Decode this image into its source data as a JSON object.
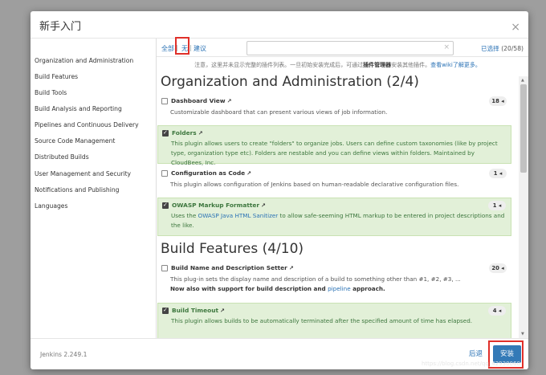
{
  "modal": {
    "title": "新手入门",
    "close": "×"
  },
  "sidebar": {
    "items": [
      "Organization and Administration",
      "Build Features",
      "Build Tools",
      "Build Analysis and Reporting",
      "Pipelines and Continuous Delivery",
      "Source Code Management",
      "Distributed Builds",
      "User Management and Security",
      "Notifications and Publishing",
      "Languages"
    ]
  },
  "toolbar": {
    "all": "全部",
    "sep": "|",
    "none": "无",
    "suggested": "建议",
    "search_placeholder": "",
    "clear": "×",
    "selected_link": "已选择",
    "selected_count": "(20/58)"
  },
  "notice": {
    "part1": "注意，这里并未显示完整的插件列表。一旦初始安装完成后，可通过",
    "bold": "插件管理器",
    "part2": "安装其他插件。",
    "link": "查看wiki了解更多。"
  },
  "sections": [
    {
      "title": "Organization and Administration (2/4)"
    },
    {
      "title": "Build Features (4/10)"
    }
  ],
  "plugins": [
    {
      "name": "Dashboard View",
      "ext": "↗",
      "deps": "18 ◂",
      "desc": "Customizable dashboard that can present various views of job information."
    },
    {
      "name": "Folders",
      "ext": "↗",
      "deps": "",
      "desc": "This plugin allows users to create \"folders\" to organize jobs. Users can define custom taxonomies (like by project type, organization type etc). Folders are nestable and you can define views within folders. Maintained by CloudBees, Inc."
    },
    {
      "name": "Configuration as Code",
      "ext": "↗",
      "deps": "1 ◂",
      "desc": "This plugin allows configuration of Jenkins based on human-readable declarative configuration files."
    },
    {
      "name": "OWASP Markup Formatter",
      "ext": "↗",
      "deps": "1 ◂",
      "desc_pre": "Uses the ",
      "desc_link": "OWASP Java HTML Sanitizer",
      "desc_post": " to allow safe-seeming HTML markup to be entered in project descriptions and the like."
    },
    {
      "name": "Build Name and Description Setter",
      "ext": "↗",
      "deps": "20 ◂",
      "desc_line1": "This plug-in sets the display name and description of a build to something other than #1, #2, #3, ...",
      "desc_bold_pre": "Now also with support for build description and ",
      "desc_bold_link": "pipeline",
      "desc_bold_post": " approach."
    },
    {
      "name": "Build Timeout",
      "ext": "↗",
      "deps": "4 ◂",
      "desc": "This plugin allows builds to be automatically terminated after the specified amount of time has elapsed."
    }
  ],
  "footer": {
    "version": "Jenkins 2.249.1",
    "back": "后退",
    "install": "安装"
  },
  "watermark": "https://blog.csdn.net/qq_42930060",
  "colors": {
    "accent": "#337ab7",
    "selected_bg": "#e2f0d8",
    "highlight": "#e0302a"
  }
}
